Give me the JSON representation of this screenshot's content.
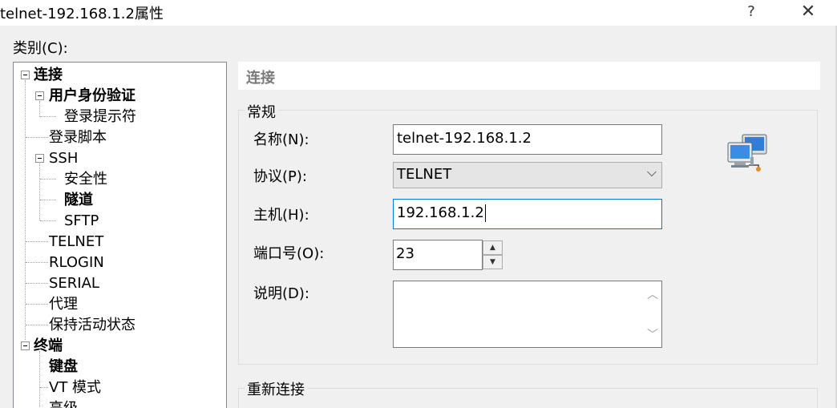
{
  "window": {
    "title": "telnet-192.168.1.2属性",
    "help_glyph": "?",
    "close_glyph": "✕"
  },
  "category_label": "类别(C):",
  "tree": {
    "items": [
      {
        "label": "连接",
        "bold": true
      },
      {
        "label": "用户身份验证",
        "bold": true
      },
      {
        "label": "登录提示符",
        "bold": false
      },
      {
        "label": "登录脚本",
        "bold": false
      },
      {
        "label": "SSH",
        "bold": false
      },
      {
        "label": "安全性",
        "bold": false
      },
      {
        "label": "隧道",
        "bold": true
      },
      {
        "label": "SFTP",
        "bold": false
      },
      {
        "label": "TELNET",
        "bold": false
      },
      {
        "label": "RLOGIN",
        "bold": false
      },
      {
        "label": "SERIAL",
        "bold": false
      },
      {
        "label": "代理",
        "bold": false
      },
      {
        "label": "保持活动状态",
        "bold": false
      },
      {
        "label": "终端",
        "bold": true
      },
      {
        "label": "键盘",
        "bold": true
      },
      {
        "label": "VT 模式",
        "bold": false
      },
      {
        "label": "高级",
        "bold": false
      }
    ]
  },
  "section": {
    "title": "连接"
  },
  "general": {
    "group_title": "常规",
    "name_label": "名称(N):",
    "name_value": "telnet-192.168.1.2",
    "protocol_label": "协议(P):",
    "protocol_value": "TELNET",
    "host_label": "主机(H):",
    "host_value": "192.168.1.2",
    "port_label": "端口号(O):",
    "port_value": "23",
    "desc_label": "说明(D):",
    "desc_value": ""
  },
  "reconnect": {
    "group_title": "重新连接"
  },
  "icons": {
    "network": "network-computers-icon",
    "spin_up": "▲",
    "spin_down": "▼",
    "dropdown": "⌵",
    "scroll_up": "︿",
    "scroll_down": "﹀"
  }
}
